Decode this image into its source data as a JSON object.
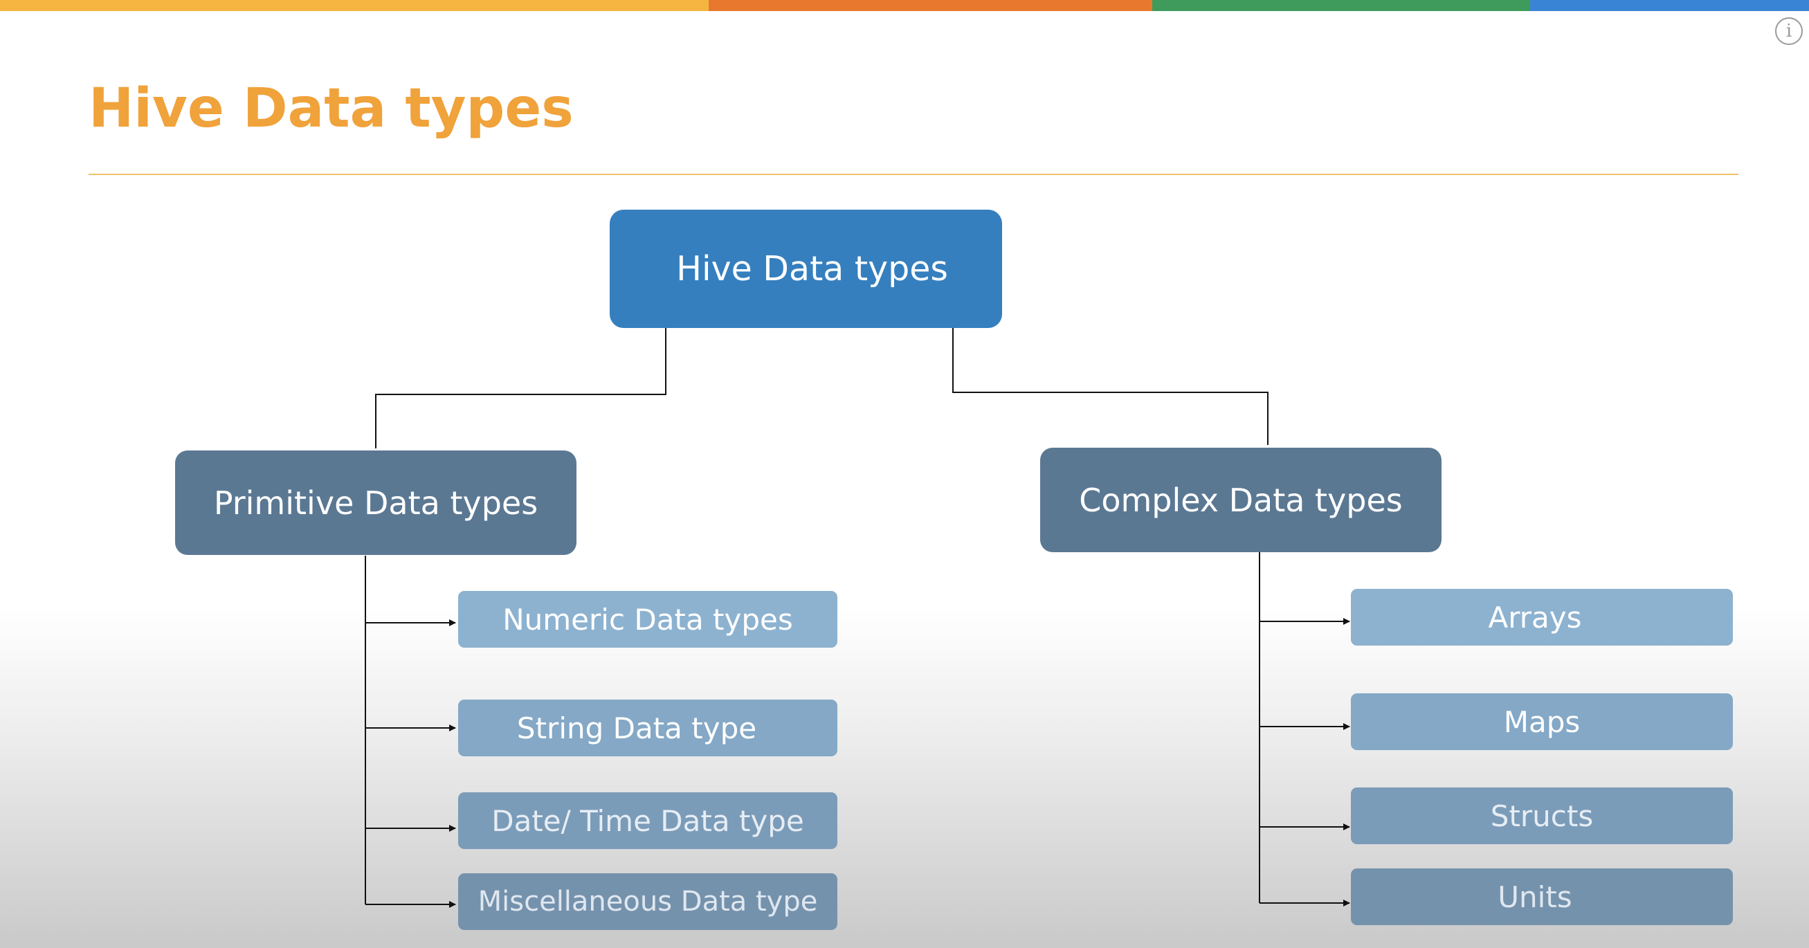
{
  "slide": {
    "title": "Hive Data types",
    "colors": {
      "title": "#f0a23b",
      "rule": "#efc26a",
      "root_box": "#357fbf",
      "category_box": "#5b7893",
      "topbar": [
        "#f5b540",
        "#e9782f",
        "#3e9b5b",
        "#3a84d6"
      ]
    },
    "info_icon": "info-icon"
  },
  "diagram": {
    "root": {
      "label": "Hive Data types"
    },
    "categories": [
      {
        "label": "Primitive Data types",
        "children": [
          {
            "label": "Numeric Data types",
            "color": "#8db2d0"
          },
          {
            "label": "String Data type",
            "color": "#84a8c6"
          },
          {
            "label": "Date/ Time Data type",
            "color": "#7b9cb9"
          },
          {
            "label": "Miscellaneous Data type",
            "color": "#7592ad"
          }
        ]
      },
      {
        "label": "Complex Data types",
        "children": [
          {
            "label": "Arrays",
            "color": "#8db2d0"
          },
          {
            "label": "Maps",
            "color": "#84a8c6"
          },
          {
            "label": "Structs",
            "color": "#7b9cb9"
          },
          {
            "label": "Units",
            "color": "#7592ad"
          }
        ]
      }
    ]
  }
}
